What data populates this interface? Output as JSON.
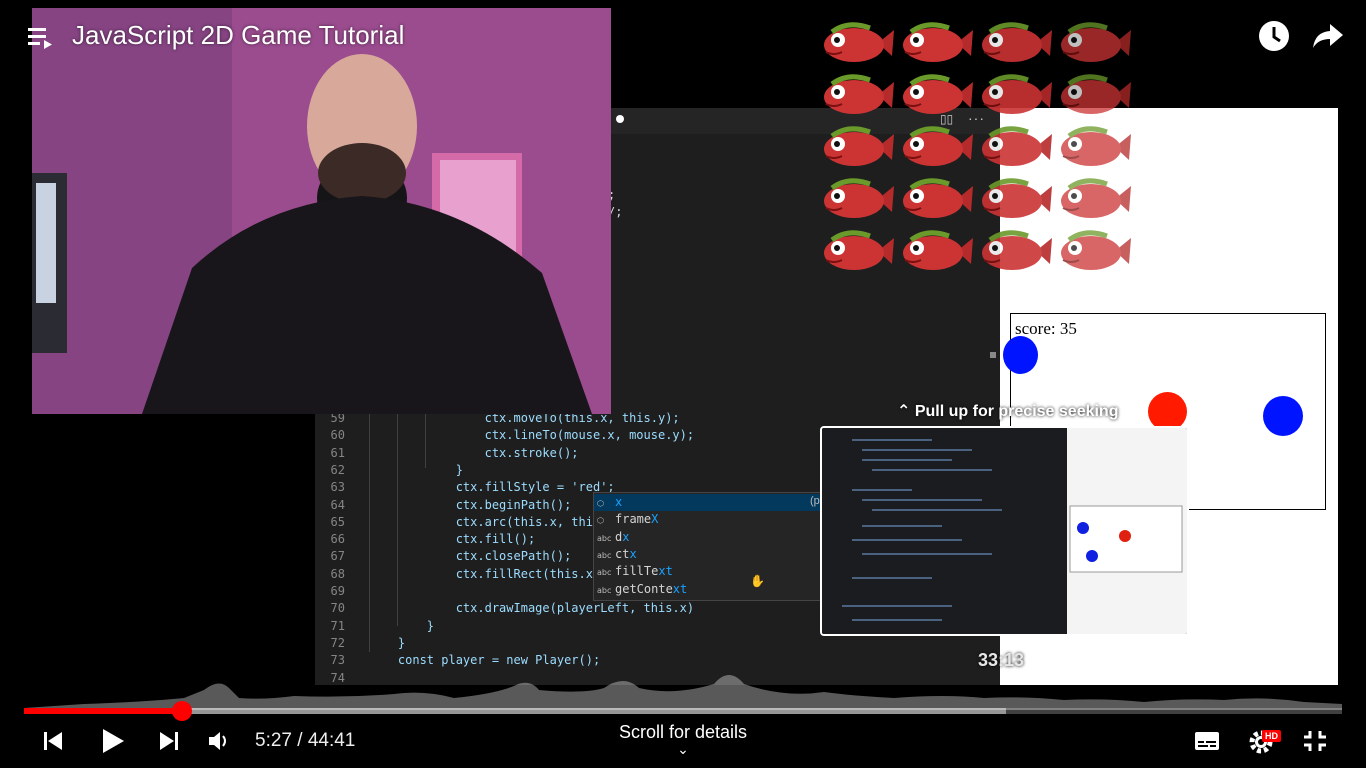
{
  "header": {
    "title": "JavaScript 2D Game Tutorial",
    "icons": [
      "playlist-icon",
      "watch-later-icon",
      "share-icon"
    ]
  },
  "editor": {
    "lines": [
      {
        "n": "59",
        "code": "                ctx.moveTo(this.x, this.y);"
      },
      {
        "n": "60",
        "code": "                ctx.lineTo(mouse.x, mouse.y);"
      },
      {
        "n": "61",
        "code": "                ctx.stroke();"
      },
      {
        "n": "62",
        "code": "            }"
      },
      {
        "n": "63",
        "code": "            ctx.fillStyle = 'red';"
      },
      {
        "n": "64",
        "code": "            ctx.beginPath();"
      },
      {
        "n": "65",
        "code": "            ctx.arc(this.x, this.y,"
      },
      {
        "n": "66",
        "code": "            ctx.fill();"
      },
      {
        "n": "67",
        "code": "            ctx.closePath();"
      },
      {
        "n": "68",
        "code": "            ctx.fillRect(this.x,this"
      },
      {
        "n": "69",
        "code": ""
      },
      {
        "n": "70",
        "code": "            ctx.drawImage(playerLeft, this.x)"
      },
      {
        "n": "71",
        "code": "        }"
      },
      {
        "n": "72",
        "code": "    }"
      },
      {
        "n": "73",
        "code": "    const player = new Player();"
      },
      {
        "n": "74",
        "code": ""
      }
    ],
    "partial_right": [
      ";",
      "/;"
    ],
    "suggestions": [
      {
        "kind": "prop",
        "label": "x",
        "hl": "x",
        "selected": true
      },
      {
        "kind": "prop",
        "label": "frame",
        "hl": "X",
        "selected": false
      },
      {
        "kind": "abc",
        "label": "d",
        "hl": "x",
        "selected": false
      },
      {
        "kind": "abc",
        "label": "ct",
        "hl": "x",
        "selected": false
      },
      {
        "kind": "abc",
        "label": "fillTe",
        "hl": "xt",
        "selected": false
      },
      {
        "kind": "abc",
        "label": "getConte",
        "hl": "xt",
        "selected": false
      }
    ],
    "suggest_hint": "(p"
  },
  "game": {
    "score_text": "score: 35"
  },
  "preview": {
    "pull_up": "Pull up for precise seeking",
    "seek_time": "33:13"
  },
  "player": {
    "time": "5:27 / 44:41",
    "progress_fraction": 0.12,
    "buffered_fraction": 0.745,
    "scroll_details": "Scroll for details",
    "hd_badge": "HD",
    "accent": "#ff0000"
  }
}
